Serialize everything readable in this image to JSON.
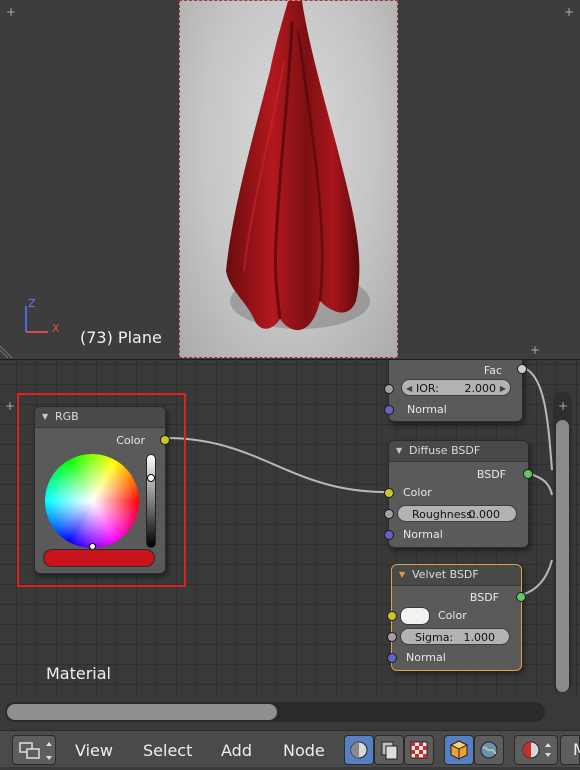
{
  "viewport": {
    "frame_label": "(73) Plane",
    "axis_z_label": "Z",
    "axis_x_label": "X"
  },
  "nodes": {
    "rgb": {
      "title": "RGB",
      "output_label": "Color",
      "color": "#c8141c"
    },
    "top_node": {
      "output_label": "Fac",
      "ior_label": "IOR:",
      "ior_value": "2.000",
      "normal_label": "Normal"
    },
    "diffuse": {
      "title": "Diffuse BSDF",
      "output_label": "BSDF",
      "color_label": "Color",
      "roughness_label": "Roughness:",
      "roughness_value": "0.000",
      "normal_label": "Normal"
    },
    "velvet": {
      "title": "Velvet BSDF",
      "output_label": "BSDF",
      "color_label": "Color",
      "sigma_label": "Sigma:",
      "sigma_value": "1.000",
      "normal_label": "Normal"
    }
  },
  "editor": {
    "material_label": "Material"
  },
  "header": {
    "menu": [
      "View",
      "Select",
      "Add",
      "Node"
    ],
    "truncated_label": "M"
  },
  "colors": {
    "accent_active": "#e3a24a",
    "highlight_box": "#e02020",
    "button_on": "#5680c2"
  }
}
